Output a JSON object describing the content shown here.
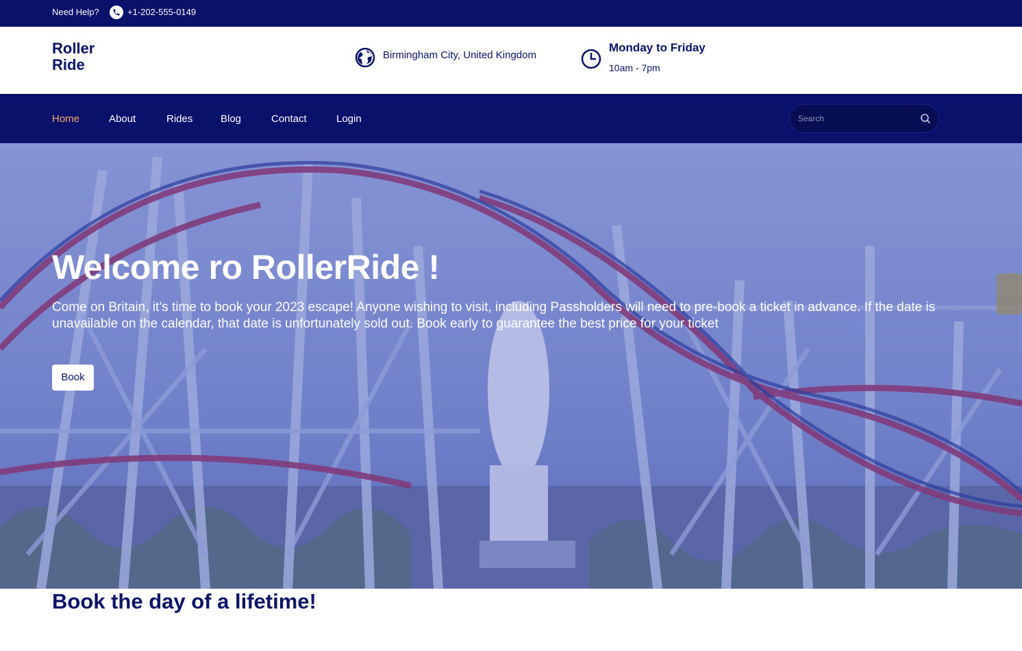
{
  "topbar": {
    "help_label": "Need Help?",
    "phone_icon": "phone-icon",
    "phone": "+1-202-555-0149"
  },
  "header": {
    "logo_line1": "Roller",
    "logo_line2": "Ride",
    "location_icon": "globe-icon",
    "location": "Birmingham City, United Kingdom",
    "hours_icon": "clock-icon",
    "hours_title": "Monday to Friday",
    "hours_time": "10am - 7pm"
  },
  "nav": {
    "items": [
      {
        "label": "Home",
        "active": true
      },
      {
        "label": "About",
        "active": false
      },
      {
        "label": "Rides",
        "active": false
      },
      {
        "label": "Blog",
        "active": false
      },
      {
        "label": "Contact",
        "active": false
      },
      {
        "label": "Login",
        "active": false
      }
    ],
    "search_placeholder": "Search",
    "search_icon": "search-icon"
  },
  "hero": {
    "title": "Welcome ro RollerRide !",
    "text": "Come on Britain, it’s time to book your 2023 escape! Anyone wishing to visit, including Passholders will need to pre-book a ticket in advance. If the date is unavailable on the calendar, that date is unfortunately sold out. Book early to guarantee the best price for your ticket",
    "button_label": "Book"
  },
  "tagline": "Book the day of a lifetime!",
  "colors": {
    "navy": "#09116b",
    "accent": "#f5a66a",
    "text": "#0b1466"
  }
}
